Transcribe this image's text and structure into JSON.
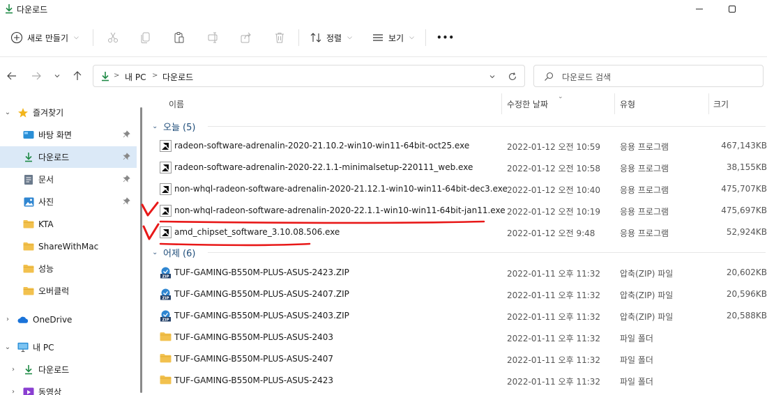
{
  "window": {
    "title": "다운로드"
  },
  "commandbar": {
    "new_label": "새로 만들기",
    "sort_label": "정렬",
    "view_label": "보기",
    "more_label": "•••"
  },
  "address": {
    "crumbs": [
      "내 PC",
      "다운로드"
    ],
    "search_placeholder": "다운로드 검색"
  },
  "nav": {
    "items": [
      {
        "label": "즐겨찾기"
      },
      {
        "label": "바탕 화면"
      },
      {
        "label": "다운로드"
      },
      {
        "label": "문서"
      },
      {
        "label": "사진"
      },
      {
        "label": "KTA"
      },
      {
        "label": "ShareWithMac"
      },
      {
        "label": "성능"
      },
      {
        "label": "오버클럭"
      },
      {
        "label": "OneDrive"
      },
      {
        "label": "내 PC"
      },
      {
        "label": "다운로드"
      },
      {
        "label": "동영상"
      }
    ]
  },
  "columns": {
    "name": "이름",
    "date": "수정한 날짜",
    "type": "유형",
    "size": "크기"
  },
  "groups": [
    {
      "label": "오늘 (5)",
      "files": [
        {
          "name": "radeon-software-adrenalin-2020-21.10.2-win10-win11-64bit-oct25.exe",
          "date": "2022-01-12 오전 10:59",
          "type": "응용 프로그램",
          "size": "467,143KB",
          "icon": "amd-exe-icon"
        },
        {
          "name": "radeon-software-adrenalin-2020-22.1.1-minimalsetup-220111_web.exe",
          "date": "2022-01-12 오전 10:58",
          "type": "응용 프로그램",
          "size": "38,155KB",
          "icon": "amd-exe-icon"
        },
        {
          "name": "non-whql-radeon-software-adrenalin-2020-21.12.1-win10-win11-64bit-dec3.exe",
          "date": "2022-01-12 오전 10:40",
          "type": "응용 프로그램",
          "size": "475,707KB",
          "icon": "amd-exe-icon"
        },
        {
          "name": "non-whql-radeon-software-adrenalin-2020-22.1.1-win10-win11-64bit-jan11.exe",
          "date": "2022-01-12 오전 10:19",
          "type": "응용 프로그램",
          "size": "475,697KB",
          "icon": "amd-exe-icon"
        },
        {
          "name": "amd_chipset_software_3.10.08.506.exe",
          "date": "2022-01-12 오전 9:48",
          "type": "응용 프로그램",
          "size": "52,924KB",
          "icon": "amd-exe-icon"
        }
      ]
    },
    {
      "label": "어제 (6)",
      "files": [
        {
          "name": "TUF-GAMING-B550M-PLUS-ASUS-2423.ZIP",
          "date": "2022-01-11 오후 11:32",
          "type": "압축(ZIP) 파일",
          "size": "20,602KB",
          "icon": "zip-icon"
        },
        {
          "name": "TUF-GAMING-B550M-PLUS-ASUS-2407.ZIP",
          "date": "2022-01-11 오후 11:32",
          "type": "압축(ZIP) 파일",
          "size": "20,596KB",
          "icon": "zip-icon"
        },
        {
          "name": "TUF-GAMING-B550M-PLUS-ASUS-2403.ZIP",
          "date": "2022-01-11 오후 11:32",
          "type": "압축(ZIP) 파일",
          "size": "20,588KB",
          "icon": "zip-icon"
        },
        {
          "name": "TUF-GAMING-B550M-PLUS-ASUS-2403",
          "date": "2022-01-11 오후 11:32",
          "type": "파일 폴더",
          "size": "",
          "icon": "folder-icon"
        },
        {
          "name": "TUF-GAMING-B550M-PLUS-ASUS-2407",
          "date": "2022-01-11 오후 11:32",
          "type": "파일 폴더",
          "size": "",
          "icon": "folder-icon"
        },
        {
          "name": "TUF-GAMING-B550M-PLUS-ASUS-2423",
          "date": "2022-01-11 오후 11:32",
          "type": "파일 폴더",
          "size": "",
          "icon": "folder-icon"
        }
      ]
    }
  ],
  "annotations": {
    "mark_color": "#e81818",
    "marks": [
      {
        "label": "V",
        "file": "non-whql-radeon-software-adrenalin-2020-22.1.1-win10-win11-64bit-jan11.exe"
      },
      {
        "label": "V",
        "file": "amd_chipset_software_3.10.08.506.exe"
      }
    ]
  },
  "colors": {
    "accent": "#1f7a3c",
    "selection": "#dbe9f7",
    "group_header": "#1f4d7a",
    "folder": "#f2c14e"
  }
}
